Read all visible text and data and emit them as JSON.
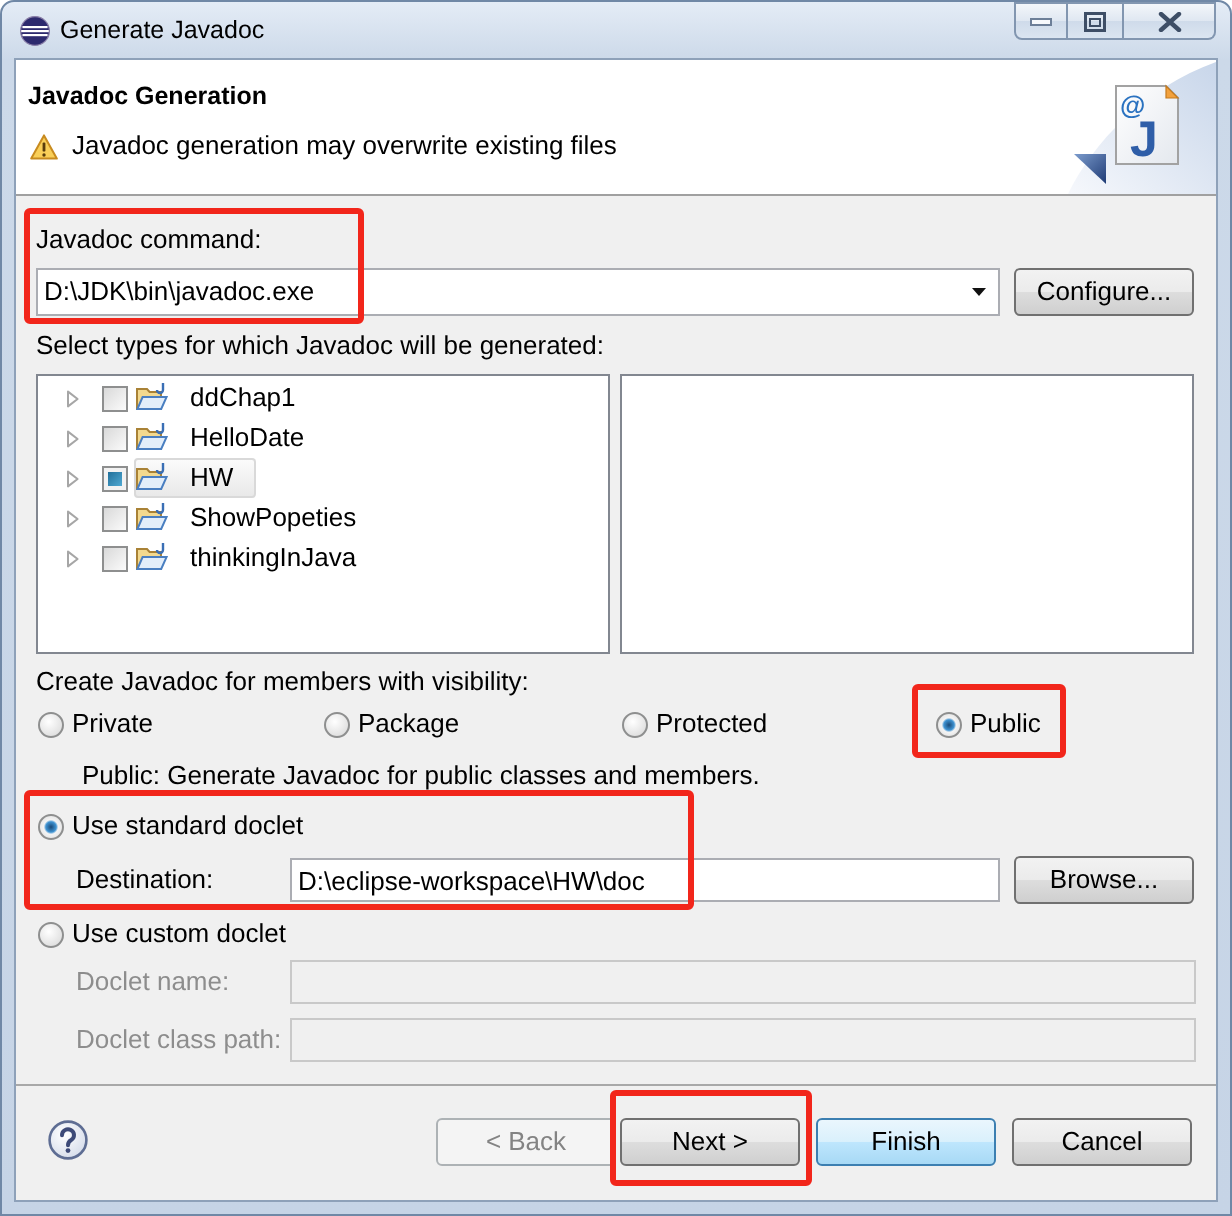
{
  "window": {
    "title": "Generate Javadoc"
  },
  "header": {
    "title": "Javadoc Generation",
    "message": "Javadoc generation may overwrite existing files",
    "banner_marks": [
      "@",
      "J"
    ]
  },
  "javadoc_command": {
    "label": "Javadoc command:",
    "value": "D:\\JDK\\bin\\javadoc.exe",
    "button": "Configure...",
    "highlighted": true
  },
  "types": {
    "label": "Select types for which Javadoc will be generated:",
    "items": [
      {
        "label": "ddChap1",
        "expanded": false,
        "checked": false,
        "selected": false
      },
      {
        "label": "HelloDate",
        "expanded": false,
        "checked": false,
        "selected": false
      },
      {
        "label": "HW",
        "expanded": false,
        "checked": true,
        "selected": true
      },
      {
        "label": "ShowPopeties",
        "expanded": false,
        "checked": false,
        "selected": false
      },
      {
        "label": "thinkingInJava",
        "expanded": false,
        "checked": false,
        "selected": false
      }
    ]
  },
  "visibility": {
    "label": "Create Javadoc for members with visibility:",
    "options": [
      {
        "label": "Private",
        "selected": false,
        "highlighted": false
      },
      {
        "label": "Package",
        "selected": false,
        "highlighted": false
      },
      {
        "label": "Protected",
        "selected": false,
        "highlighted": false
      },
      {
        "label": "Public",
        "selected": true,
        "highlighted": true
      }
    ],
    "description": "Public: Generate Javadoc for public classes and members."
  },
  "standard_doclet": {
    "label": "Use standard doclet",
    "selected": true,
    "highlighted": true,
    "destination_label": "Destination:",
    "destination": "D:\\eclipse-workspace\\HW\\doc",
    "button": "Browse..."
  },
  "custom_doclet": {
    "label": "Use custom doclet",
    "selected": false,
    "fields": [
      {
        "label": "Doclet name:",
        "disabled": true
      },
      {
        "label": "Doclet class path:",
        "disabled": true
      }
    ]
  },
  "buttons": [
    {
      "label": "< Back",
      "disabled": true,
      "default": false,
      "highlighted": false
    },
    {
      "label": "Next >",
      "disabled": false,
      "default": false,
      "highlighted": true
    },
    {
      "label": "Finish",
      "disabled": false,
      "default": true,
      "highlighted": false
    },
    {
      "label": "Cancel",
      "disabled": false,
      "default": false,
      "highlighted": false
    }
  ]
}
